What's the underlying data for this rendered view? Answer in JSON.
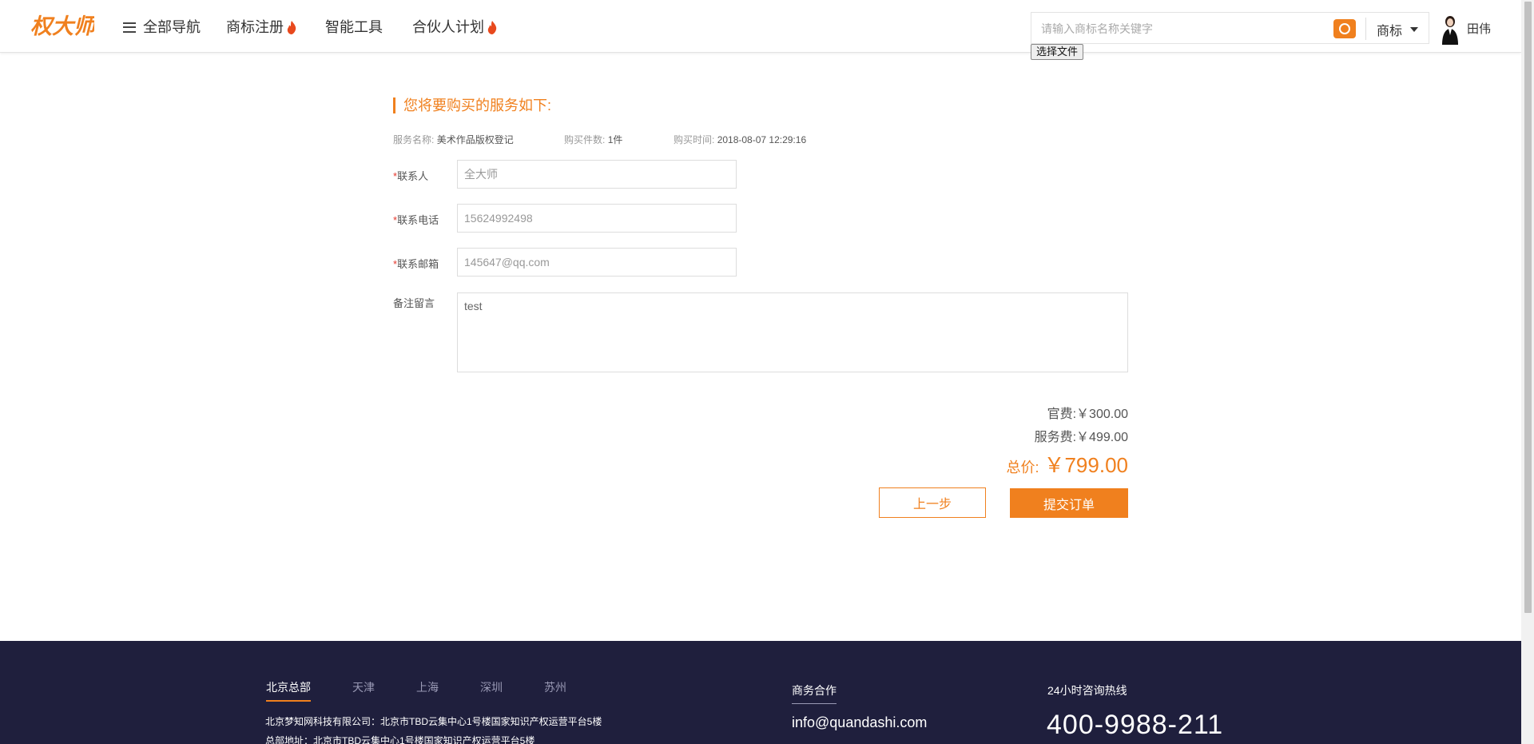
{
  "colors": {
    "accent": "#f0801e",
    "footer_bg": "#1f1f3d",
    "required": "#e5372c"
  },
  "header": {
    "logo_text": "权大师",
    "nav": [
      {
        "label": "全部导航",
        "icon": "menu-icon"
      },
      {
        "label": "商标注册",
        "icon": "flame-icon"
      },
      {
        "label": "智能工具"
      },
      {
        "label": "合伙人计划",
        "icon": "flame-icon"
      }
    ],
    "search": {
      "placeholder": "请输入商标名称关键字",
      "category": "商标",
      "file_button": "选择文件"
    },
    "user": {
      "name": "田伟"
    }
  },
  "order": {
    "title": "您将要购买的服务如下:",
    "service_name_label": "服务名称:",
    "service_name": "美术作品版权登记",
    "quantity_label": "购买件数:",
    "quantity": "1件",
    "time_label": "购买时间:",
    "time": "2018-08-07 12:29:16"
  },
  "form": {
    "contact_label": "联系人",
    "contact_value": "全大师",
    "phone_label": "联系电话",
    "phone_value": "15624992498",
    "email_label": "联系邮箱",
    "email_value": "145647@qq.com",
    "note_label": "备注留言",
    "note_value": "test"
  },
  "fees": {
    "official_label": "官费:",
    "official_value": "￥300.00",
    "service_label": "服务费:",
    "service_value": "￥499.00",
    "total_label": "总价:",
    "total_value": "￥799.00"
  },
  "buttons": {
    "prev": "上一步",
    "submit": "提交订单"
  },
  "footer": {
    "cities": [
      "北京总部",
      "天津",
      "上海",
      "深圳",
      "苏州"
    ],
    "address_line1": "北京梦知网科技有限公司：北京市TBD云集中心1号楼国家知识产权运营平台5楼",
    "address_line2": "总部地址：北京市TBD云集中心1号楼国家知识产权运营平台5楼",
    "business_heading": "商务合作",
    "email": "info@quandashi.com",
    "hotline_heading": "24小时咨询热线",
    "phone": "400-9988-211"
  }
}
